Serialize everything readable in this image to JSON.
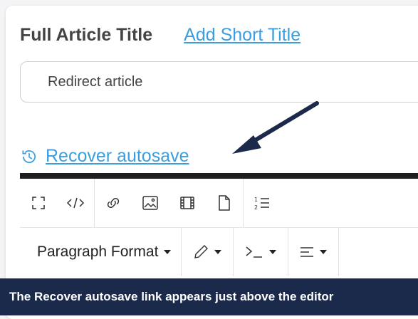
{
  "form": {
    "title_label": "Full Article Title",
    "short_title_link": "Add Short Title",
    "title_value": "Redirect article",
    "recover_link": "Recover autosave"
  },
  "toolbar": {
    "row1_icons": [
      "fullscreen-icon",
      "code-view-icon",
      "link-icon",
      "image-icon",
      "video-icon",
      "file-icon",
      "ordered-list-icon"
    ],
    "paragraph_format": "Paragraph Format",
    "row2_icons": [
      "text-color-icon",
      "code-block-icon",
      "align-icon"
    ]
  },
  "caption": "The Recover autosave link appears just above the editor",
  "colors": {
    "link": "#3b9ee0",
    "arrow": "#1b2a4a",
    "caption_bg": "#1b2a4a"
  }
}
